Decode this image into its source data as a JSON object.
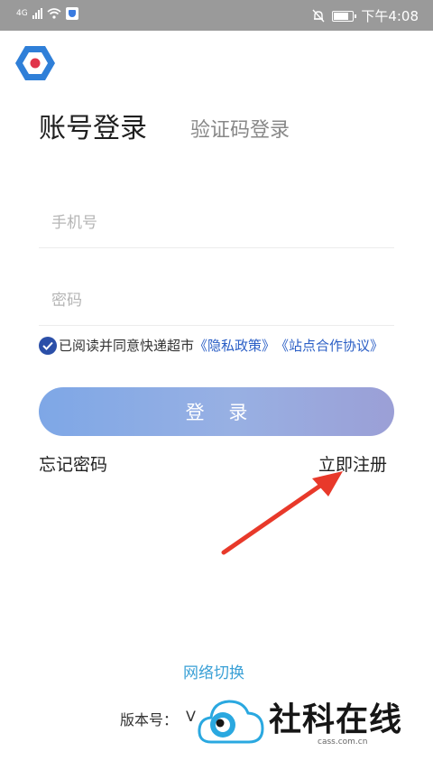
{
  "status_bar": {
    "network_type": "4G",
    "time": "下午4:08"
  },
  "login": {
    "tab_account": "账号登录",
    "tab_sms": "验证码登录",
    "phone_placeholder": "手机号",
    "password_placeholder": "密码",
    "agreement_prefix": "已阅读并同意快递超市",
    "privacy_link": "《隐私政策》",
    "cooperation_link": "《站点合作协议》",
    "login_button": "登 录",
    "forgot_password": "忘记密码",
    "register": "立即注册"
  },
  "footer": {
    "network_switch": "网络切换",
    "version_label": "版本号：",
    "version_value": "V"
  },
  "watermark": {
    "brand": "社科在线",
    "domain": "cass.com.cn"
  },
  "colors": {
    "accent": "#2b5fc6",
    "button_start": "#7ea7e6",
    "button_end": "#9b9fd6",
    "annotation_arrow": "#e8392a"
  }
}
